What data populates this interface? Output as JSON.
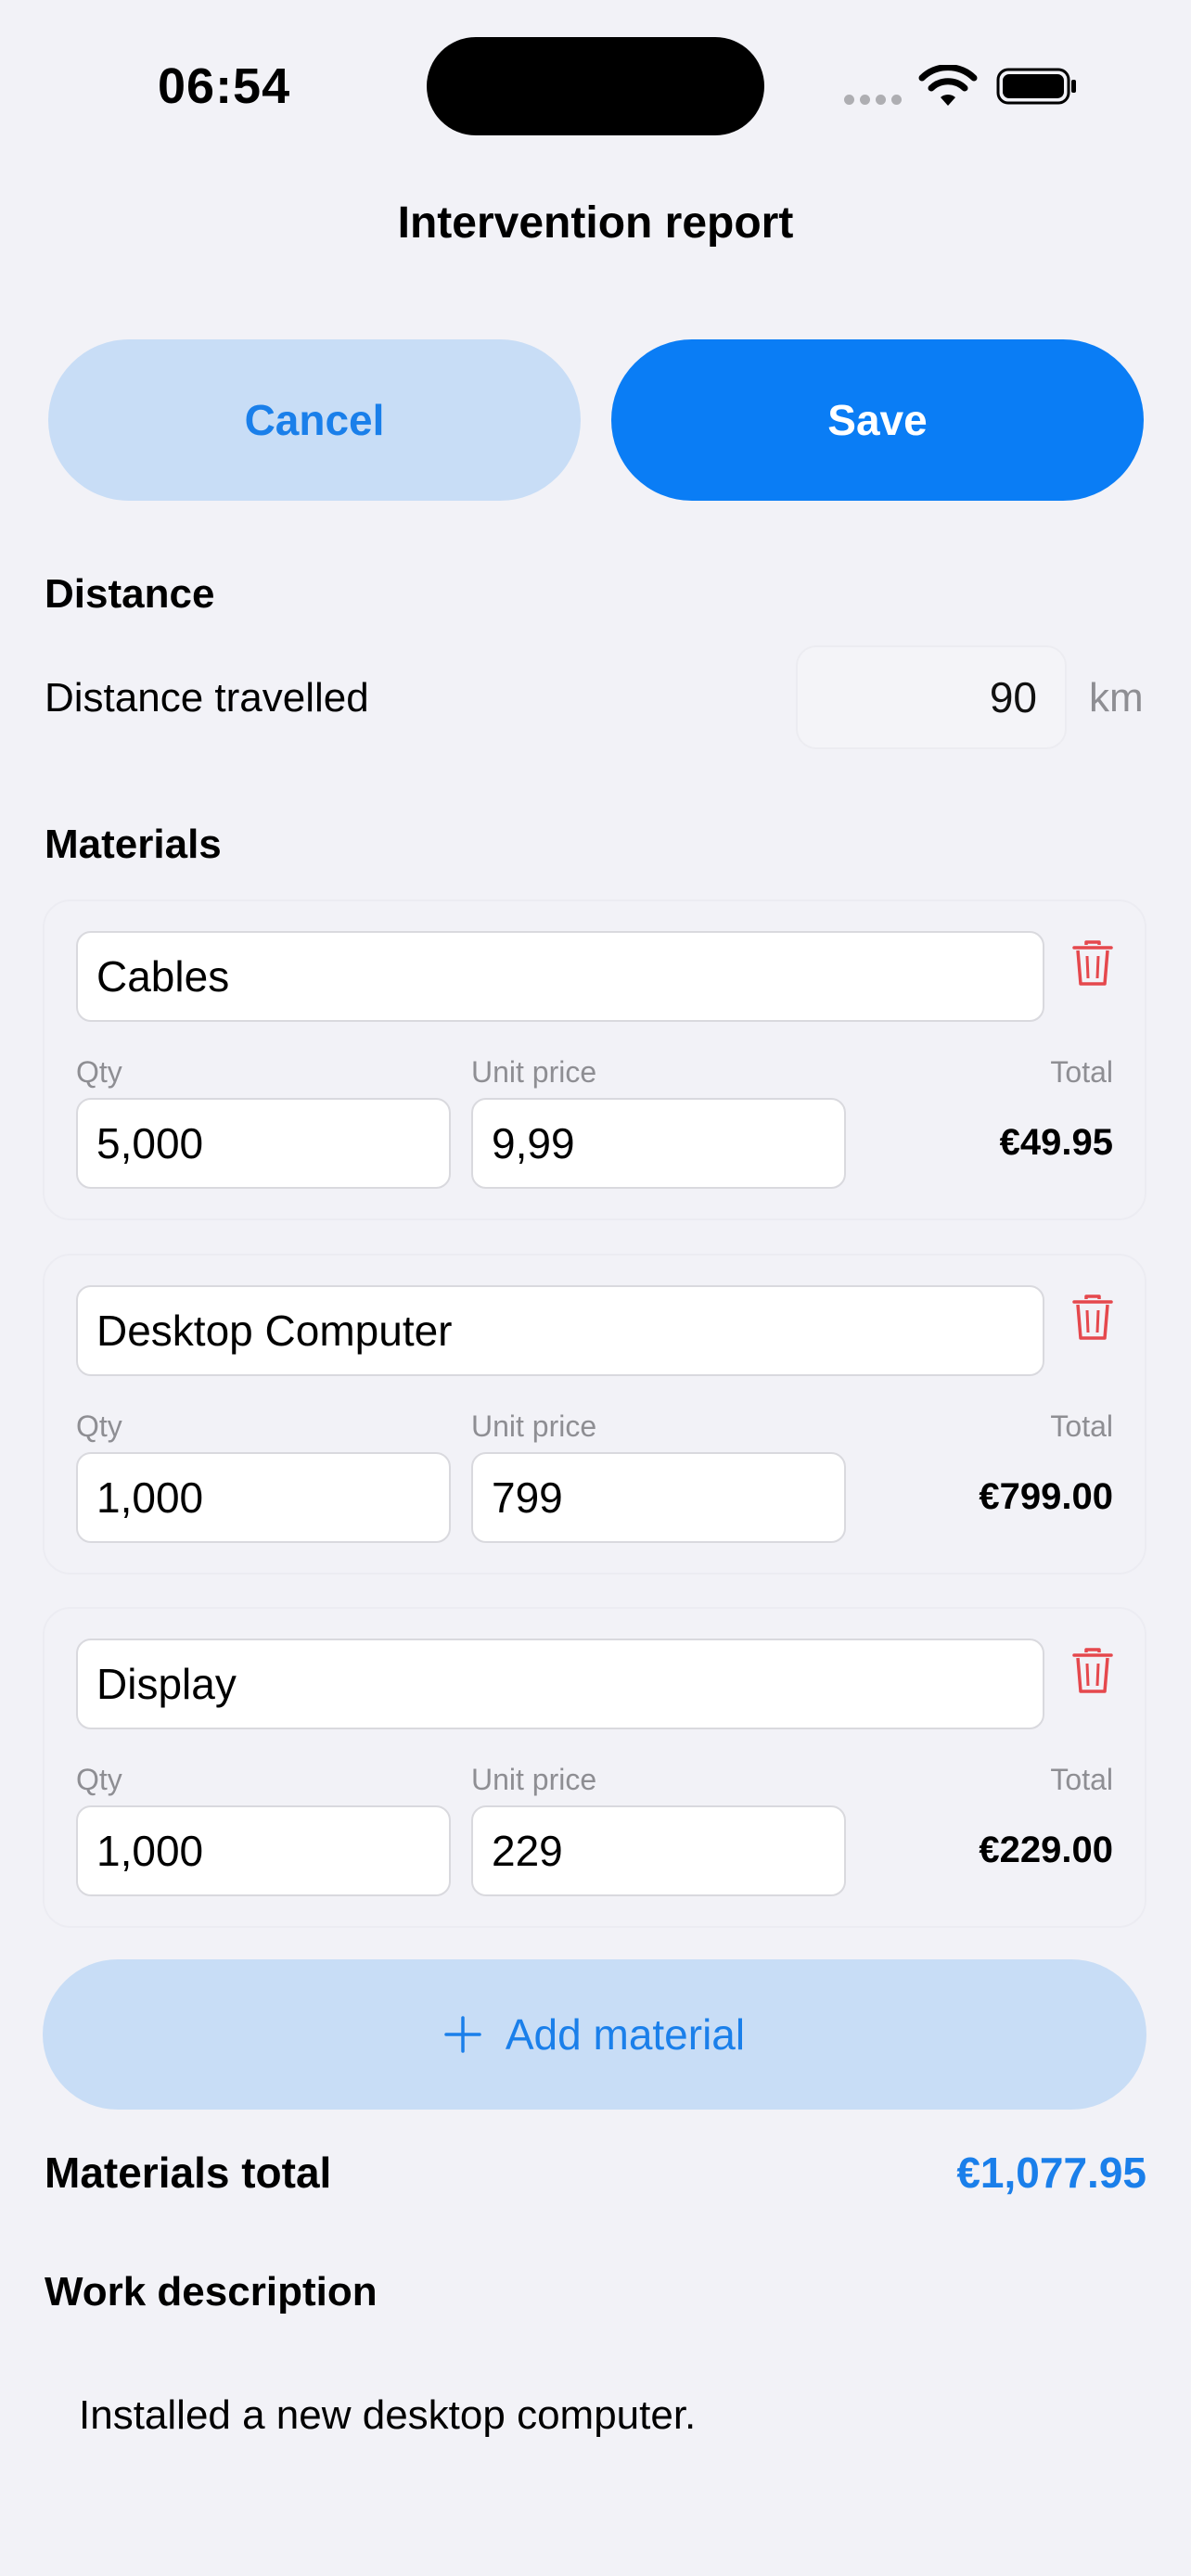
{
  "status_bar": {
    "time": "06:54"
  },
  "nav": {
    "title": "Intervention report"
  },
  "actions": {
    "cancel_label": "Cancel",
    "save_label": "Save"
  },
  "distance": {
    "section_title": "Distance",
    "label": "Distance travelled",
    "value": "90",
    "unit": "km"
  },
  "materials": {
    "section_title": "Materials",
    "qty_label": "Qty",
    "unit_price_label": "Unit price",
    "total_label": "Total",
    "items": [
      {
        "name": "Cables",
        "qty": "5,000",
        "unit_price": "9,99",
        "total": "€49.95"
      },
      {
        "name": "Desktop Computer",
        "qty": "1,000",
        "unit_price": "799",
        "total": "€799.00"
      },
      {
        "name": "Display",
        "qty": "1,000",
        "unit_price": "229",
        "total": "€229.00"
      }
    ],
    "add_label": "Add material",
    "total_row_label": "Materials total",
    "total_row_value": "€1,077.95"
  },
  "work": {
    "section_title": "Work description",
    "text": "Installed a new desktop computer."
  },
  "colors": {
    "accent": "#0a7df5",
    "accent_light": "#c8ddf6",
    "delete": "#e5484d",
    "background": "#f2f2f7"
  }
}
